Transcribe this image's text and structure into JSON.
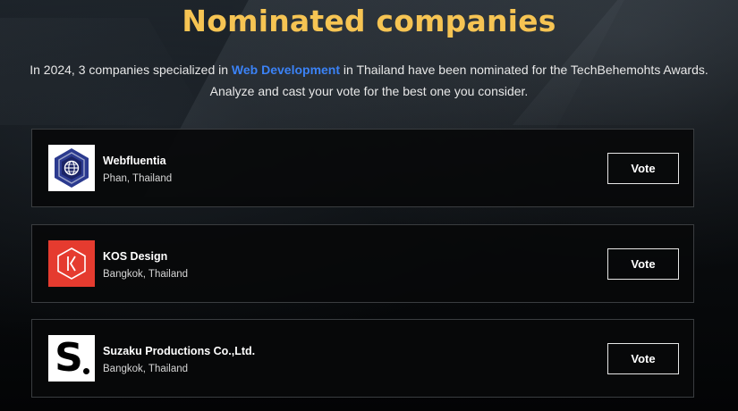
{
  "heading": "Nominated companies",
  "intro": {
    "pre": "In 2024, 3 companies specialized in ",
    "highlight": "Web Development",
    "post": " in Thailand have been nominated for the TechBehemohts Awards.",
    "line2": "Analyze and cast your vote for the best one you consider."
  },
  "colors": {
    "heading": "#f6c453",
    "highlight": "#3b82f6",
    "kos_brand": "#e53b2f",
    "webfluentia_brand": "#2b3a8f"
  },
  "companies": [
    {
      "name": "Webfluentia",
      "location": "Phan, Thailand",
      "vote_label": "Vote",
      "logo_icon": "globe-hexagon-logo-icon"
    },
    {
      "name": "KOS Design",
      "location": "Bangkok, Thailand",
      "vote_label": "Vote",
      "logo_icon": "k-hexagon-logo-icon"
    },
    {
      "name": "Suzaku Productions Co.,Ltd.",
      "location": "Bangkok, Thailand",
      "vote_label": "Vote",
      "logo_icon": "s-letter-logo-icon"
    }
  ],
  "logo_text": {
    "suzaku": "S"
  }
}
